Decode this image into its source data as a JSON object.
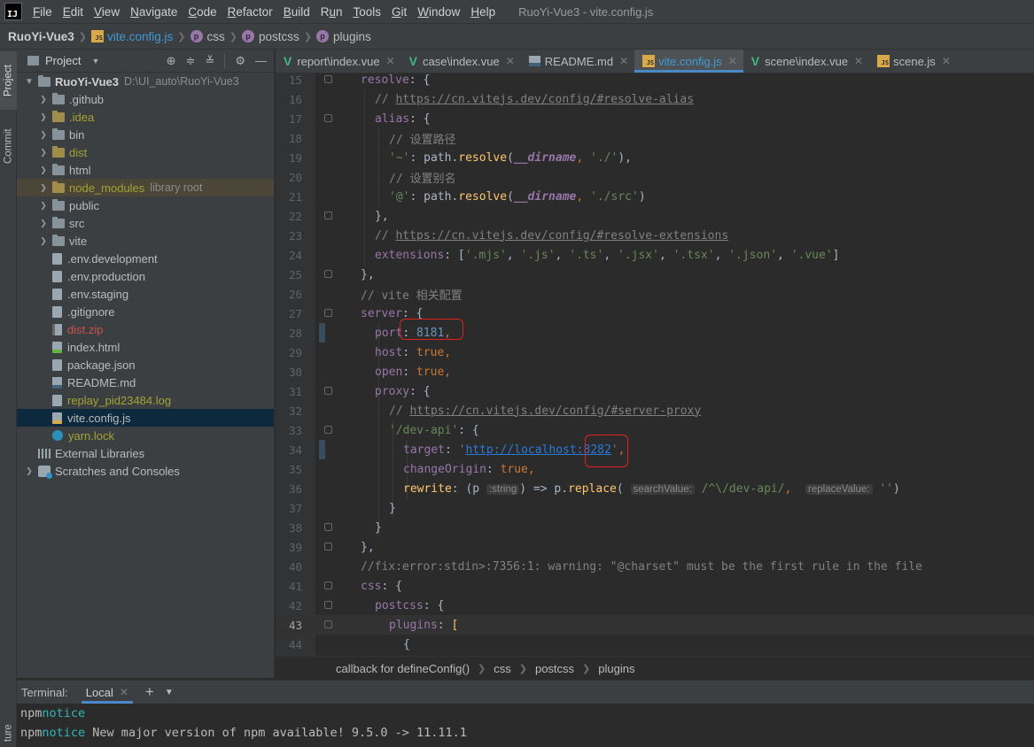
{
  "window": {
    "title": "RuoYi-Vue3 - vite.config.js",
    "logo": "IJ"
  },
  "menu": [
    {
      "pre": "",
      "u": "F",
      "post": "ile"
    },
    {
      "pre": "",
      "u": "E",
      "post": "dit"
    },
    {
      "pre": "",
      "u": "V",
      "post": "iew"
    },
    {
      "pre": "",
      "u": "N",
      "post": "avigate"
    },
    {
      "pre": "",
      "u": "C",
      "post": "ode"
    },
    {
      "pre": "",
      "u": "R",
      "post": "efactor"
    },
    {
      "pre": "",
      "u": "B",
      "post": "uild"
    },
    {
      "pre": "R",
      "u": "u",
      "post": "n"
    },
    {
      "pre": "",
      "u": "T",
      "post": "ools"
    },
    {
      "pre": "",
      "u": "G",
      "post": "it"
    },
    {
      "pre": "",
      "u": "W",
      "post": "indow"
    },
    {
      "pre": "",
      "u": "H",
      "post": "elp"
    }
  ],
  "breadcrumb": [
    "RuoYi-Vue3",
    "vite.config.js",
    "css",
    "postcss",
    "plugins"
  ],
  "stripe": {
    "project": "Project",
    "commit": "Commit",
    "structure": "ture"
  },
  "project_panel": {
    "title": "Project",
    "root_name": "RuoYi-Vue3",
    "root_path": "D:\\UI_auto\\RuoYi-Vue3",
    "items": [
      {
        "label": ".github",
        "kind": "folder"
      },
      {
        "label": ".idea",
        "kind": "folder-yellow"
      },
      {
        "label": "bin",
        "kind": "folder"
      },
      {
        "label": "dist",
        "kind": "folder-yellow"
      },
      {
        "label": "html",
        "kind": "folder"
      },
      {
        "label": "node_modules",
        "extra": "library root",
        "kind": "folder-lib"
      },
      {
        "label": "public",
        "kind": "folder"
      },
      {
        "label": "src",
        "kind": "folder"
      },
      {
        "label": "vite",
        "kind": "folder"
      },
      {
        "label": ".env.development",
        "kind": "file"
      },
      {
        "label": ".env.production",
        "kind": "file"
      },
      {
        "label": ".env.staging",
        "kind": "file"
      },
      {
        "label": ".gitignore",
        "kind": "file"
      },
      {
        "label": "dist.zip",
        "kind": "zip"
      },
      {
        "label": "index.html",
        "kind": "html"
      },
      {
        "label": "package.json",
        "kind": "file"
      },
      {
        "label": "README.md",
        "kind": "md"
      },
      {
        "label": "replay_pid23484.log",
        "kind": "log"
      },
      {
        "label": "vite.config.js",
        "kind": "js"
      },
      {
        "label": "yarn.lock",
        "kind": "yarn"
      },
      {
        "label": "External Libraries",
        "kind": "lib"
      },
      {
        "label": "Scratches and Consoles",
        "kind": "scratch"
      }
    ]
  },
  "tabs": [
    {
      "label": "report\\index.vue",
      "icon": "vue",
      "active": false
    },
    {
      "label": "case\\index.vue",
      "icon": "vue",
      "active": false
    },
    {
      "label": "README.md",
      "icon": "md",
      "active": false
    },
    {
      "label": "vite.config.js",
      "icon": "js",
      "active": true
    },
    {
      "label": "scene\\index.vue",
      "icon": "vue",
      "active": false
    },
    {
      "label": "scene.js",
      "icon": "js",
      "active": false
    }
  ],
  "editor": {
    "line_numbers": [
      "15",
      "16",
      "17",
      "18",
      "19",
      "20",
      "21",
      "22",
      "23",
      "24",
      "25",
      "26",
      "27",
      "28",
      "29",
      "30",
      "31",
      "32",
      "33",
      "34",
      "35",
      "36",
      "37",
      "38",
      "39",
      "40",
      "41",
      "42",
      "43",
      "44"
    ],
    "current_line": "43",
    "code": {
      "resolve": "resolve",
      "alias": "alias",
      "cmt_alias_url": "https://cn.vitejs.dev/config/#resolve-alias",
      "cmt_set_path": "// 设置路径",
      "cmt_set_alias": "// 设置别名",
      "path_fn": "resolve",
      "dirname": "__dirname",
      "alias_tilde": "'~'",
      "path_root": "'./'",
      "alias_at": "'@'",
      "path_src": "'./src'",
      "cmt_ext_url": "https://cn.vitejs.dev/config/#resolve-extensions",
      "extensions": "extensions",
      "ext_list": [
        "'.mjs'",
        "'.js'",
        "'.ts'",
        "'.jsx'",
        "'.tsx'",
        "'.json'",
        "'.vue'"
      ],
      "cmt_vite": "// vite 相关配置",
      "server": "server",
      "port": "port",
      "port_value": "8181",
      "host": "host",
      "open": "open",
      "true_kw": "true",
      "proxy": "proxy",
      "cmt_proxy_url": "https://cn.vitejs.dev/config/#server-proxy",
      "dev_api": "'/dev-api'",
      "target": "target",
      "target_url": "http://localhost:8282",
      "change_origin": "changeOrigin",
      "rewrite": "rewrite",
      "param": "p",
      "hint_string": ":string",
      "replace_fn": "replace",
      "hint_search": "searchValue:",
      "regex": "/^\\/dev-api/",
      "hint_replace": "replaceValue:",
      "empty_str": "''",
      "cmt_fix": "//fix:error:stdin>:7356:1: warning: \"@charset\" must be the first rule in the file",
      "css": "css",
      "postcss": "postcss",
      "plugins": "plugins"
    }
  },
  "editor_breadcrumb": [
    "callback for defineConfig()",
    "css",
    "postcss",
    "plugins"
  ],
  "terminal": {
    "label": "Terminal:",
    "tab": "Local",
    "lines": [
      {
        "prefix": "npm",
        "tag": "notice",
        "text": ""
      },
      {
        "prefix": "npm",
        "tag": "notice",
        "text": " New major version of npm available! 9.5.0 -> 11.11.1"
      }
    ]
  }
}
